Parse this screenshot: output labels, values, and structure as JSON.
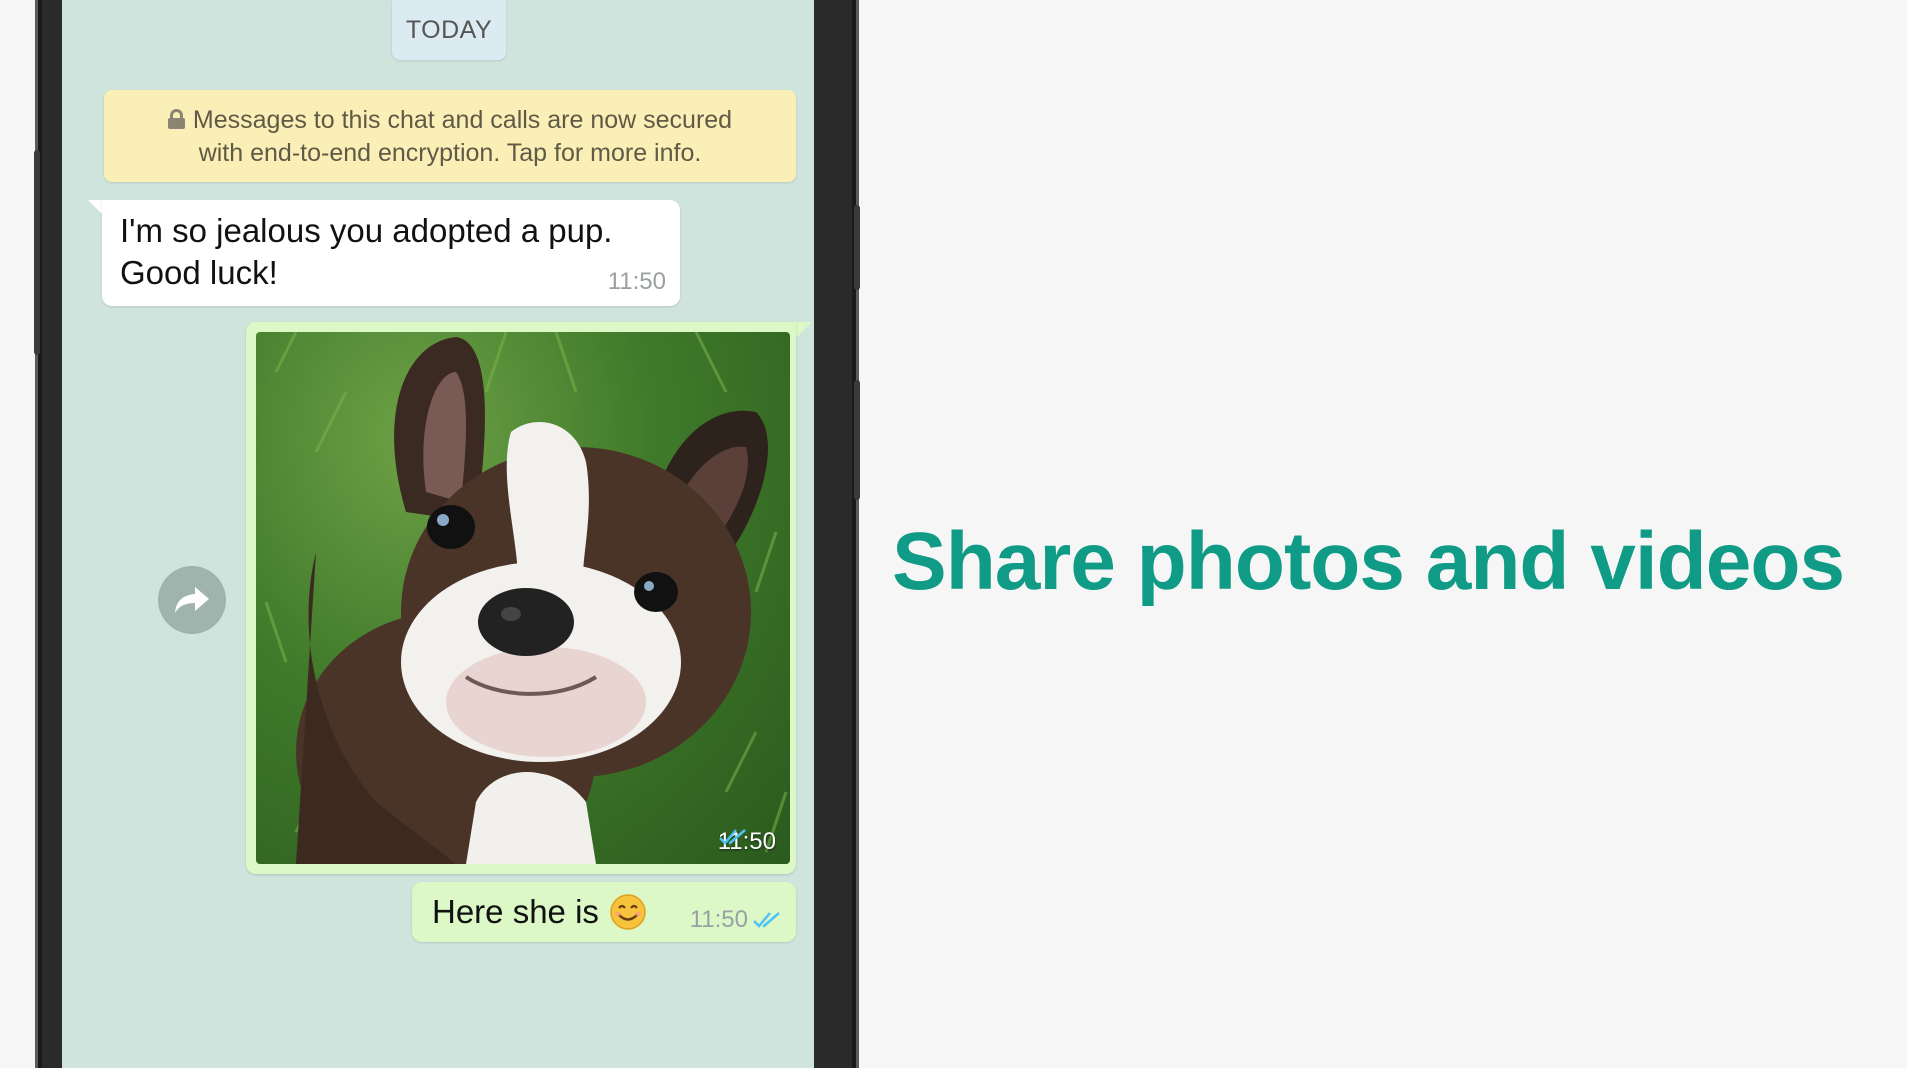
{
  "chat": {
    "date_label": "TODAY",
    "encryption_notice": {
      "line1": "Messages to this chat and calls are now secured",
      "line2": "with end-to-end encryption. Tap for more info."
    },
    "incoming_message": {
      "line1": "I'm so jealous you adopted a pup.",
      "line2": "Good luck!",
      "time": "11:50"
    },
    "photo_message": {
      "time": "11:50",
      "status": "read"
    },
    "outgoing_message": {
      "text": "Here she is",
      "time": "11:50",
      "status": "read"
    }
  },
  "headline": "Share photos and videos",
  "colors": {
    "accent": "#0f9b86",
    "chat_background": "#cfe4dc",
    "outgoing_bubble": "#dcf8c6",
    "read_ticks": "#4fc3f7"
  },
  "icons": [
    "lock-icon",
    "forward-icon",
    "double-check-icon",
    "smiling-face-emoji"
  ]
}
